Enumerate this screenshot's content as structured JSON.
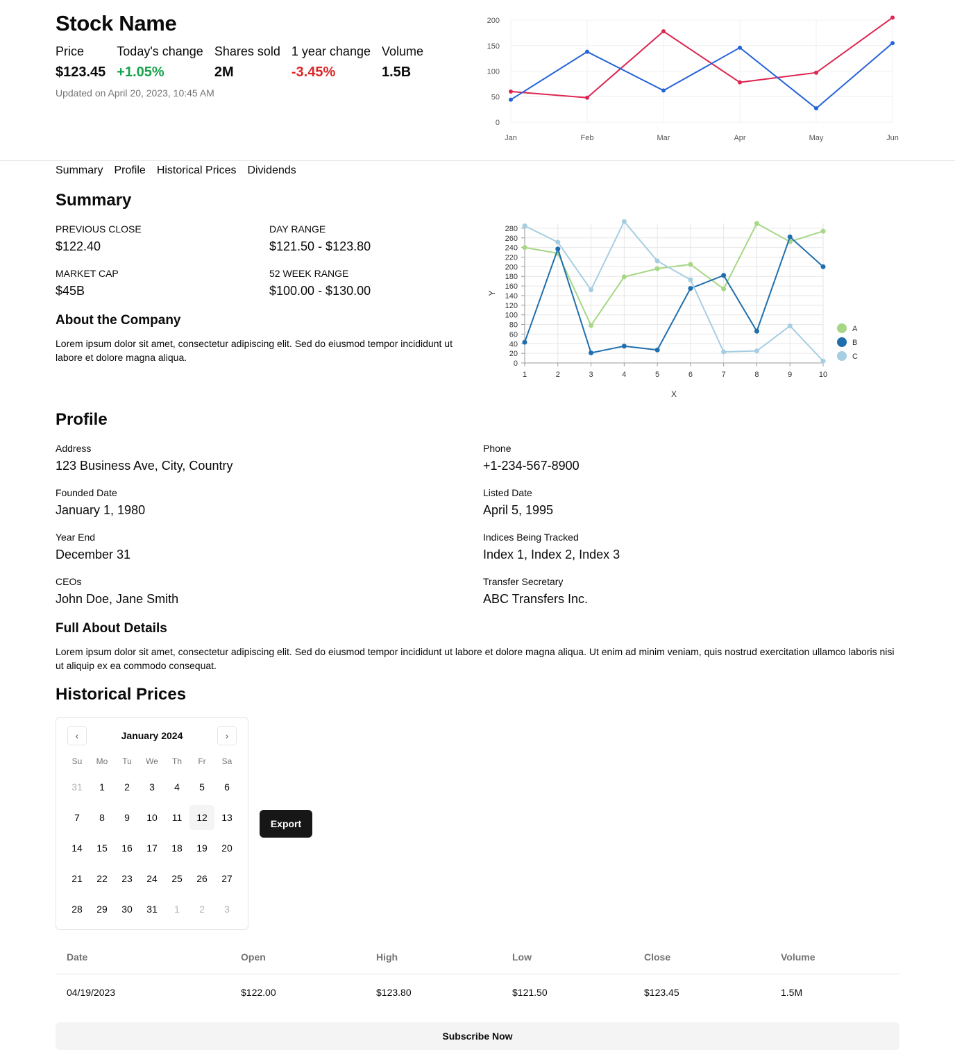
{
  "header": {
    "title": "Stock Name",
    "metrics": [
      {
        "label": "Price",
        "value": "$123.45",
        "tone": "neutral"
      },
      {
        "label": "Today's change",
        "value": "+1.05%",
        "tone": "positive"
      },
      {
        "label": "Shares sold",
        "value": "2M",
        "tone": "neutral"
      },
      {
        "label": "1 year change",
        "value": "-3.45%",
        "tone": "negative"
      },
      {
        "label": "Volume",
        "value": "1.5B",
        "tone": "neutral"
      }
    ],
    "updated": "Updated on April 20, 2023, 10:45 AM"
  },
  "tabs": [
    "Summary",
    "Profile",
    "Historical Prices",
    "Dividends"
  ],
  "summary": {
    "title": "Summary",
    "stats": [
      {
        "label": "PREVIOUS CLOSE",
        "value": "$122.40"
      },
      {
        "label": "DAY RANGE",
        "value": "$121.50 - $123.80"
      },
      {
        "label": "MARKET CAP",
        "value": "$45B"
      },
      {
        "label": "52 WEEK RANGE",
        "value": "$100.00 - $130.00"
      }
    ],
    "about_title": "About the Company",
    "about_text": "Lorem ipsum dolor sit amet, consectetur adipiscing elit. Sed do eiusmod tempor incididunt ut labore et dolore magna aliqua."
  },
  "profile": {
    "title": "Profile",
    "fields": [
      {
        "label": "Address",
        "value": "123 Business Ave, City, Country"
      },
      {
        "label": "Phone",
        "value": "+1-234-567-8900"
      },
      {
        "label": "Founded Date",
        "value": "January 1, 1980"
      },
      {
        "label": "Listed Date",
        "value": "April 5, 1995"
      },
      {
        "label": "Year End",
        "value": "December 31"
      },
      {
        "label": "Indices Being Tracked",
        "value": "Index 1, Index 2, Index 3"
      },
      {
        "label": "CEOs",
        "value": "John Doe, Jane Smith"
      },
      {
        "label": "Transfer Secretary",
        "value": "ABC Transfers Inc."
      }
    ],
    "full_about_title": "Full About Details",
    "full_about_text": "Lorem ipsum dolor sit amet, consectetur adipiscing elit. Sed do eiusmod tempor incididunt ut labore et dolore magna aliqua. Ut enim ad minim veniam, quis nostrud exercitation ullamco laboris nisi ut aliquip ex ea commodo consequat."
  },
  "historical": {
    "title": "Historical Prices",
    "calendar": {
      "month": "January 2024",
      "weekdays": [
        "Su",
        "Mo",
        "Tu",
        "We",
        "Th",
        "Fr",
        "Sa"
      ],
      "days": [
        {
          "d": "31",
          "muted": true
        },
        {
          "d": "1"
        },
        {
          "d": "2"
        },
        {
          "d": "3"
        },
        {
          "d": "4"
        },
        {
          "d": "5"
        },
        {
          "d": "6"
        },
        {
          "d": "7"
        },
        {
          "d": "8"
        },
        {
          "d": "9"
        },
        {
          "d": "10"
        },
        {
          "d": "11"
        },
        {
          "d": "12",
          "today": true
        },
        {
          "d": "13"
        },
        {
          "d": "14"
        },
        {
          "d": "15"
        },
        {
          "d": "16"
        },
        {
          "d": "17"
        },
        {
          "d": "18"
        },
        {
          "d": "19"
        },
        {
          "d": "20"
        },
        {
          "d": "21"
        },
        {
          "d": "22"
        },
        {
          "d": "23"
        },
        {
          "d": "24"
        },
        {
          "d": "25"
        },
        {
          "d": "26"
        },
        {
          "d": "27"
        },
        {
          "d": "28"
        },
        {
          "d": "29"
        },
        {
          "d": "30"
        },
        {
          "d": "31"
        },
        {
          "d": "1",
          "muted": true
        },
        {
          "d": "2",
          "muted": true
        },
        {
          "d": "3",
          "muted": true
        }
      ]
    },
    "export_label": "Export",
    "table": {
      "columns": [
        "Date",
        "Open",
        "High",
        "Low",
        "Close",
        "Volume"
      ],
      "rows": [
        [
          "04/19/2023",
          "$122.00",
          "$123.80",
          "$121.50",
          "$123.45",
          "1.5M"
        ]
      ]
    }
  },
  "subscribe_label": "Subscribe Now",
  "colors": {
    "positive": "#16a34a",
    "negative": "#dc2626",
    "line_red": "#dc2651",
    "line_blue": "#2563d9",
    "series_a": "#a6d785",
    "series_b": "#1f6fae",
    "series_c": "#a6cee3"
  },
  "chart_data": [
    {
      "type": "line",
      "categories": [
        "Jan",
        "Feb",
        "Mar",
        "Apr",
        "May",
        "Jun"
      ],
      "ylim": [
        0,
        200
      ],
      "yticks": [
        0,
        50,
        100,
        150,
        200
      ],
      "grid": true,
      "series": [
        {
          "values": [
            60,
            48,
            178,
            78,
            97,
            205
          ],
          "color": "#dc2651"
        },
        {
          "values": [
            44,
            138,
            62,
            146,
            27,
            155
          ],
          "color": "#2563d9"
        }
      ]
    },
    {
      "type": "line",
      "x": [
        1,
        2,
        3,
        4,
        5,
        6,
        7,
        8,
        9,
        10
      ],
      "xlabel": "X",
      "ylabel": "Y",
      "ylim": [
        0,
        290
      ],
      "yticks": [
        0,
        20,
        40,
        60,
        80,
        100,
        120,
        140,
        160,
        180,
        200,
        220,
        240,
        260,
        280
      ],
      "grid": true,
      "legend": "right",
      "series": [
        {
          "name": "A",
          "values": [
            240,
            228,
            78,
            179,
            196,
            205,
            154,
            290,
            252,
            274
          ],
          "color": "#a6d785"
        },
        {
          "name": "B",
          "values": [
            43,
            237,
            21,
            35,
            27,
            155,
            182,
            66,
            262,
            200
          ],
          "color": "#1f6fae"
        },
        {
          "name": "C",
          "values": [
            285,
            251,
            152,
            294,
            212,
            173,
            23,
            25,
            77,
            4
          ],
          "color": "#a6cee3"
        }
      ]
    }
  ]
}
